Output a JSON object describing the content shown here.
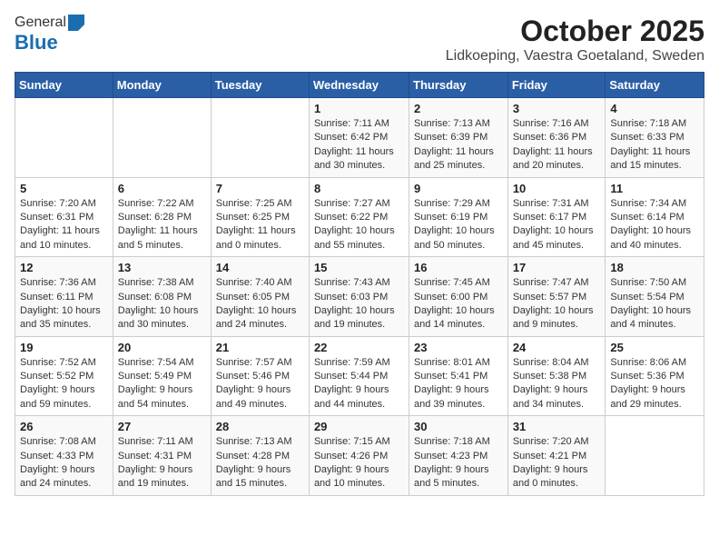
{
  "header": {
    "logo_general": "General",
    "logo_blue": "Blue",
    "title": "October 2025",
    "subtitle": "Lidkoeping, Vaestra Goetaland, Sweden"
  },
  "days_of_week": [
    "Sunday",
    "Monday",
    "Tuesday",
    "Wednesday",
    "Thursday",
    "Friday",
    "Saturday"
  ],
  "weeks": [
    [
      {
        "date": "",
        "info": ""
      },
      {
        "date": "",
        "info": ""
      },
      {
        "date": "",
        "info": ""
      },
      {
        "date": "1",
        "info": "Sunrise: 7:11 AM\nSunset: 6:42 PM\nDaylight: 11 hours\nand 30 minutes."
      },
      {
        "date": "2",
        "info": "Sunrise: 7:13 AM\nSunset: 6:39 PM\nDaylight: 11 hours\nand 25 minutes."
      },
      {
        "date": "3",
        "info": "Sunrise: 7:16 AM\nSunset: 6:36 PM\nDaylight: 11 hours\nand 20 minutes."
      },
      {
        "date": "4",
        "info": "Sunrise: 7:18 AM\nSunset: 6:33 PM\nDaylight: 11 hours\nand 15 minutes."
      }
    ],
    [
      {
        "date": "5",
        "info": "Sunrise: 7:20 AM\nSunset: 6:31 PM\nDaylight: 11 hours\nand 10 minutes."
      },
      {
        "date": "6",
        "info": "Sunrise: 7:22 AM\nSunset: 6:28 PM\nDaylight: 11 hours\nand 5 minutes."
      },
      {
        "date": "7",
        "info": "Sunrise: 7:25 AM\nSunset: 6:25 PM\nDaylight: 11 hours\nand 0 minutes."
      },
      {
        "date": "8",
        "info": "Sunrise: 7:27 AM\nSunset: 6:22 PM\nDaylight: 10 hours\nand 55 minutes."
      },
      {
        "date": "9",
        "info": "Sunrise: 7:29 AM\nSunset: 6:19 PM\nDaylight: 10 hours\nand 50 minutes."
      },
      {
        "date": "10",
        "info": "Sunrise: 7:31 AM\nSunset: 6:17 PM\nDaylight: 10 hours\nand 45 minutes."
      },
      {
        "date": "11",
        "info": "Sunrise: 7:34 AM\nSunset: 6:14 PM\nDaylight: 10 hours\nand 40 minutes."
      }
    ],
    [
      {
        "date": "12",
        "info": "Sunrise: 7:36 AM\nSunset: 6:11 PM\nDaylight: 10 hours\nand 35 minutes."
      },
      {
        "date": "13",
        "info": "Sunrise: 7:38 AM\nSunset: 6:08 PM\nDaylight: 10 hours\nand 30 minutes."
      },
      {
        "date": "14",
        "info": "Sunrise: 7:40 AM\nSunset: 6:05 PM\nDaylight: 10 hours\nand 24 minutes."
      },
      {
        "date": "15",
        "info": "Sunrise: 7:43 AM\nSunset: 6:03 PM\nDaylight: 10 hours\nand 19 minutes."
      },
      {
        "date": "16",
        "info": "Sunrise: 7:45 AM\nSunset: 6:00 PM\nDaylight: 10 hours\nand 14 minutes."
      },
      {
        "date": "17",
        "info": "Sunrise: 7:47 AM\nSunset: 5:57 PM\nDaylight: 10 hours\nand 9 minutes."
      },
      {
        "date": "18",
        "info": "Sunrise: 7:50 AM\nSunset: 5:54 PM\nDaylight: 10 hours\nand 4 minutes."
      }
    ],
    [
      {
        "date": "19",
        "info": "Sunrise: 7:52 AM\nSunset: 5:52 PM\nDaylight: 9 hours\nand 59 minutes."
      },
      {
        "date": "20",
        "info": "Sunrise: 7:54 AM\nSunset: 5:49 PM\nDaylight: 9 hours\nand 54 minutes."
      },
      {
        "date": "21",
        "info": "Sunrise: 7:57 AM\nSunset: 5:46 PM\nDaylight: 9 hours\nand 49 minutes."
      },
      {
        "date": "22",
        "info": "Sunrise: 7:59 AM\nSunset: 5:44 PM\nDaylight: 9 hours\nand 44 minutes."
      },
      {
        "date": "23",
        "info": "Sunrise: 8:01 AM\nSunset: 5:41 PM\nDaylight: 9 hours\nand 39 minutes."
      },
      {
        "date": "24",
        "info": "Sunrise: 8:04 AM\nSunset: 5:38 PM\nDaylight: 9 hours\nand 34 minutes."
      },
      {
        "date": "25",
        "info": "Sunrise: 8:06 AM\nSunset: 5:36 PM\nDaylight: 9 hours\nand 29 minutes."
      }
    ],
    [
      {
        "date": "26",
        "info": "Sunrise: 7:08 AM\nSunset: 4:33 PM\nDaylight: 9 hours\nand 24 minutes."
      },
      {
        "date": "27",
        "info": "Sunrise: 7:11 AM\nSunset: 4:31 PM\nDaylight: 9 hours\nand 19 minutes."
      },
      {
        "date": "28",
        "info": "Sunrise: 7:13 AM\nSunset: 4:28 PM\nDaylight: 9 hours\nand 15 minutes."
      },
      {
        "date": "29",
        "info": "Sunrise: 7:15 AM\nSunset: 4:26 PM\nDaylight: 9 hours\nand 10 minutes."
      },
      {
        "date": "30",
        "info": "Sunrise: 7:18 AM\nSunset: 4:23 PM\nDaylight: 9 hours\nand 5 minutes."
      },
      {
        "date": "31",
        "info": "Sunrise: 7:20 AM\nSunset: 4:21 PM\nDaylight: 9 hours\nand 0 minutes."
      },
      {
        "date": "",
        "info": ""
      }
    ]
  ]
}
